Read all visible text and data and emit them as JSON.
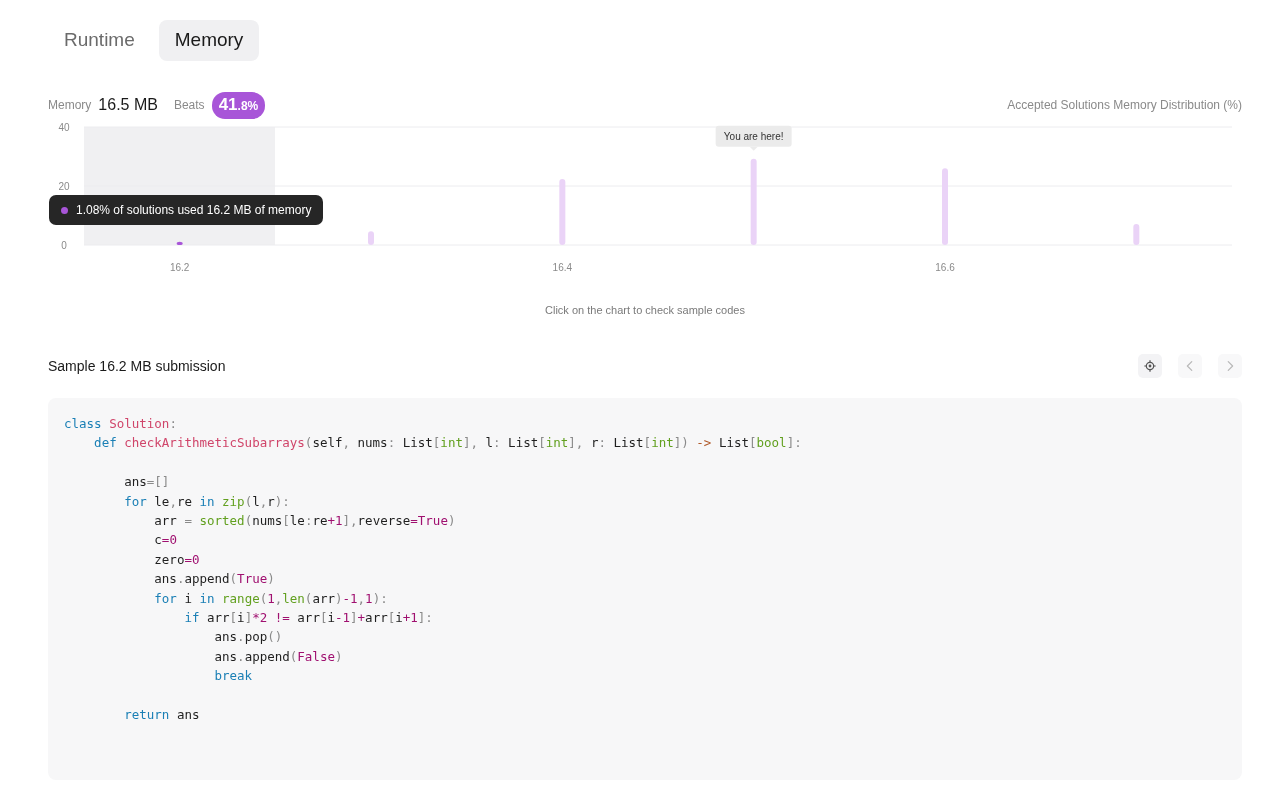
{
  "tabs": [
    {
      "label": "Runtime",
      "selected": false
    },
    {
      "label": "Memory",
      "selected": true
    }
  ],
  "stats": {
    "label": "Memory",
    "value": "16.5 MB",
    "beats_label": "Beats",
    "beats_whole": "41",
    "beats_fraction": ".8%"
  },
  "chart": {
    "tooltip": "1.08% of solutions used 16.2 MB of memory",
    "chart_data": {
      "type": "bar",
      "title": "Accepted Solutions Memory Distribution (%)",
      "x": [
        16.2,
        16.3,
        16.4,
        16.5,
        16.6,
        16.7
      ],
      "series": [
        {
          "color": "#a855d8",
          "values": [
            1.1,
            null,
            null,
            null,
            null,
            null
          ]
        },
        {
          "color": "#ead3f7",
          "values": [
            null,
            4.7,
            22.4,
            29.2,
            26,
            7.1
          ]
        }
      ],
      "xlim": [
        16.15,
        16.75
      ],
      "ylim": [
        0,
        40
      ],
      "yticks": [
        0,
        20,
        40
      ],
      "xticks": [
        16.2,
        16.4,
        16.6
      ],
      "annotations": [
        {
          "x": 16.5,
          "y": 29.2,
          "text": "You are here!"
        }
      ]
    },
    "hint": "Click on the chart to check sample codes"
  },
  "sample": {
    "title": "Sample 16.2 MB submission",
    "buttons": [
      {
        "kind": "locate",
        "disabled": false
      },
      {
        "kind": "prev",
        "disabled": true
      },
      {
        "kind": "next",
        "disabled": true
      }
    ]
  },
  "code": [
    {
      "kind": "code",
      "tokens": [
        {
          "kind": "keyword",
          "text": "class"
        },
        {
          "kind": "name",
          "text": " Solution"
        },
        {
          "kind": "punct",
          "text": ":"
        }
      ]
    },
    {
      "kind": "code",
      "tokens": [
        {
          "kind": "keyword",
          "text": "    def"
        },
        {
          "kind": "name",
          "text": " checkArithmeticSubarrays"
        },
        {
          "kind": "punct",
          "text": "("
        },
        {
          "kind": "plain",
          "text": "self"
        },
        {
          "kind": "punct",
          "text": ", "
        },
        {
          "kind": "plain",
          "text": "nums"
        },
        {
          "kind": "punct",
          "text": ": "
        },
        {
          "kind": "plain",
          "text": "List"
        },
        {
          "kind": "punct",
          "text": "["
        },
        {
          "kind": "type",
          "text": "int"
        },
        {
          "kind": "punct",
          "text": "], "
        },
        {
          "kind": "plain",
          "text": "l"
        },
        {
          "kind": "punct",
          "text": ": "
        },
        {
          "kind": "plain",
          "text": "List"
        },
        {
          "kind": "punct",
          "text": "["
        },
        {
          "kind": "type",
          "text": "int"
        },
        {
          "kind": "punct",
          "text": "], "
        },
        {
          "kind": "plain",
          "text": "r"
        },
        {
          "kind": "punct",
          "text": ": "
        },
        {
          "kind": "plain",
          "text": "List"
        },
        {
          "kind": "punct",
          "text": "["
        },
        {
          "kind": "type",
          "text": "int"
        },
        {
          "kind": "punct",
          "text": "])"
        },
        {
          "kind": "arrow",
          "text": " ->"
        },
        {
          "kind": "plain",
          "text": " List"
        },
        {
          "kind": "punct",
          "text": "["
        },
        {
          "kind": "type",
          "text": "bool"
        },
        {
          "kind": "punct",
          "text": "]:"
        }
      ]
    },
    {
      "kind": "blank"
    },
    {
      "kind": "code",
      "tokens": [
        {
          "kind": "plain",
          "text": "        ans"
        },
        {
          "kind": "punct",
          "text": "=[]"
        }
      ]
    },
    {
      "kind": "code",
      "tokens": [
        {
          "kind": "keyword",
          "text": "        for"
        },
        {
          "kind": "plain",
          "text": " le"
        },
        {
          "kind": "punct",
          "text": ","
        },
        {
          "kind": "plain",
          "text": "re "
        },
        {
          "kind": "keyword",
          "text": "in"
        },
        {
          "kind": "builtin",
          "text": " zip"
        },
        {
          "kind": "punct",
          "text": "("
        },
        {
          "kind": "plain",
          "text": "l"
        },
        {
          "kind": "punct",
          "text": ","
        },
        {
          "kind": "plain",
          "text": "r"
        },
        {
          "kind": "punct",
          "text": "):"
        }
      ]
    },
    {
      "kind": "code",
      "tokens": [
        {
          "kind": "plain",
          "text": "            arr "
        },
        {
          "kind": "punct",
          "text": "="
        },
        {
          "kind": "builtin",
          "text": " sorted"
        },
        {
          "kind": "punct",
          "text": "("
        },
        {
          "kind": "plain",
          "text": "nums"
        },
        {
          "kind": "punct",
          "text": "["
        },
        {
          "kind": "plain",
          "text": "le"
        },
        {
          "kind": "punct",
          "text": ":"
        },
        {
          "kind": "plain",
          "text": "re"
        },
        {
          "kind": "op",
          "text": "+"
        },
        {
          "kind": "number",
          "text": "1"
        },
        {
          "kind": "punct",
          "text": "],"
        },
        {
          "kind": "plain",
          "text": "reverse"
        },
        {
          "kind": "op",
          "text": "="
        },
        {
          "kind": "number",
          "text": "True"
        },
        {
          "kind": "punct",
          "text": ")"
        }
      ]
    },
    {
      "kind": "code",
      "tokens": [
        {
          "kind": "plain",
          "text": "            c"
        },
        {
          "kind": "op",
          "text": "="
        },
        {
          "kind": "number",
          "text": "0"
        }
      ]
    },
    {
      "kind": "code",
      "tokens": [
        {
          "kind": "plain",
          "text": "            zero"
        },
        {
          "kind": "op",
          "text": "="
        },
        {
          "kind": "number",
          "text": "0"
        }
      ]
    },
    {
      "kind": "code",
      "tokens": [
        {
          "kind": "plain",
          "text": "            ans"
        },
        {
          "kind": "punct",
          "text": "."
        },
        {
          "kind": "plain",
          "text": "append"
        },
        {
          "kind": "punct",
          "text": "("
        },
        {
          "kind": "number",
          "text": "True"
        },
        {
          "kind": "punct",
          "text": ")"
        }
      ]
    },
    {
      "kind": "code",
      "tokens": [
        {
          "kind": "keyword",
          "text": "            for"
        },
        {
          "kind": "plain",
          "text": " i "
        },
        {
          "kind": "keyword",
          "text": "in"
        },
        {
          "kind": "builtin",
          "text": " range"
        },
        {
          "kind": "punct",
          "text": "("
        },
        {
          "kind": "number",
          "text": "1"
        },
        {
          "kind": "punct",
          "text": ","
        },
        {
          "kind": "builtin",
          "text": "len"
        },
        {
          "kind": "punct",
          "text": "("
        },
        {
          "kind": "plain",
          "text": "arr"
        },
        {
          "kind": "punct",
          "text": ")"
        },
        {
          "kind": "op",
          "text": "-"
        },
        {
          "kind": "number",
          "text": "1"
        },
        {
          "kind": "punct",
          "text": ","
        },
        {
          "kind": "number",
          "text": "1"
        },
        {
          "kind": "punct",
          "text": "):"
        }
      ]
    },
    {
      "kind": "code",
      "tokens": [
        {
          "kind": "keyword",
          "text": "                if"
        },
        {
          "kind": "plain",
          "text": " arr"
        },
        {
          "kind": "punct",
          "text": "["
        },
        {
          "kind": "plain",
          "text": "i"
        },
        {
          "kind": "punct",
          "text": "]"
        },
        {
          "kind": "op",
          "text": "*"
        },
        {
          "kind": "number",
          "text": "2"
        },
        {
          "kind": "op",
          "text": " !="
        },
        {
          "kind": "plain",
          "text": " arr"
        },
        {
          "kind": "punct",
          "text": "["
        },
        {
          "kind": "plain",
          "text": "i"
        },
        {
          "kind": "op",
          "text": "-"
        },
        {
          "kind": "number",
          "text": "1"
        },
        {
          "kind": "punct",
          "text": "]"
        },
        {
          "kind": "op",
          "text": "+"
        },
        {
          "kind": "plain",
          "text": "arr"
        },
        {
          "kind": "punct",
          "text": "["
        },
        {
          "kind": "plain",
          "text": "i"
        },
        {
          "kind": "op",
          "text": "+"
        },
        {
          "kind": "number",
          "text": "1"
        },
        {
          "kind": "punct",
          "text": "]:"
        }
      ]
    },
    {
      "kind": "code",
      "tokens": [
        {
          "kind": "plain",
          "text": "                    ans"
        },
        {
          "kind": "punct",
          "text": "."
        },
        {
          "kind": "plain",
          "text": "pop"
        },
        {
          "kind": "punct",
          "text": "()"
        }
      ]
    },
    {
      "kind": "code",
      "tokens": [
        {
          "kind": "plain",
          "text": "                    ans"
        },
        {
          "kind": "punct",
          "text": "."
        },
        {
          "kind": "plain",
          "text": "append"
        },
        {
          "kind": "punct",
          "text": "("
        },
        {
          "kind": "number",
          "text": "False"
        },
        {
          "kind": "punct",
          "text": ")"
        }
      ]
    },
    {
      "kind": "code",
      "tokens": [
        {
          "kind": "keyword",
          "text": "                    break"
        }
      ]
    },
    {
      "kind": "blank"
    },
    {
      "kind": "code",
      "tokens": [
        {
          "kind": "keyword",
          "text": "        return"
        },
        {
          "kind": "plain",
          "text": " ans"
        }
      ]
    }
  ]
}
